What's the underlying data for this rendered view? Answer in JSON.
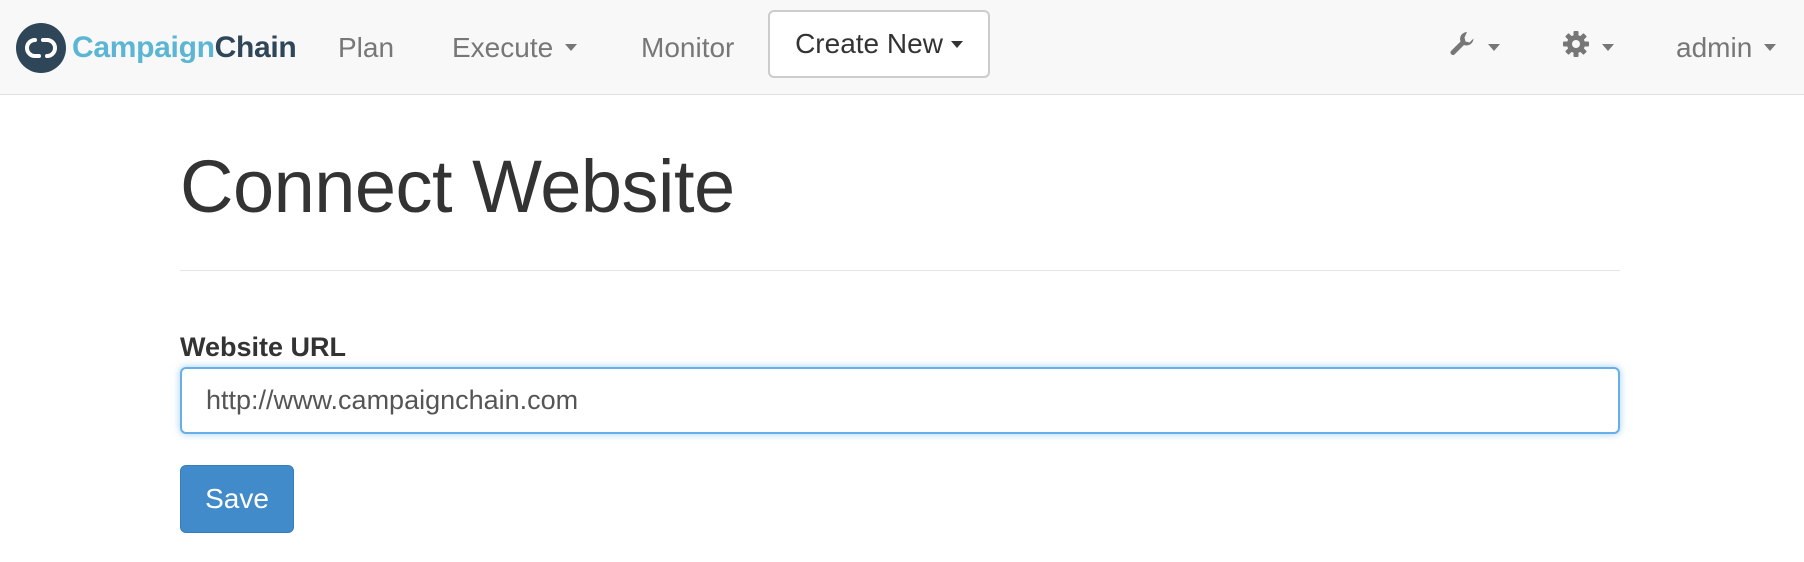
{
  "navbar": {
    "brand": {
      "part1": "Campaign",
      "part2": "Chain",
      "logo_icon": "chain-link-icon"
    },
    "items": [
      {
        "label": "Plan",
        "dropdown": false
      },
      {
        "label": "Execute",
        "dropdown": true
      },
      {
        "label": "Monitor",
        "dropdown": false
      }
    ],
    "create_new": {
      "label": "Create New",
      "dropdown": true
    },
    "right": {
      "tools_icon": "wrench-icon",
      "settings_icon": "gear-icon",
      "user_label": "admin"
    }
  },
  "main": {
    "title": "Connect Website",
    "form": {
      "url_label": "Website URL",
      "url_value": "http://www.campaignchain.com",
      "save_label": "Save"
    }
  },
  "colors": {
    "brand_light": "#5bb5d4",
    "brand_dark": "#2f4659",
    "primary_button": "#428bca",
    "focus_border": "#66afe9"
  }
}
